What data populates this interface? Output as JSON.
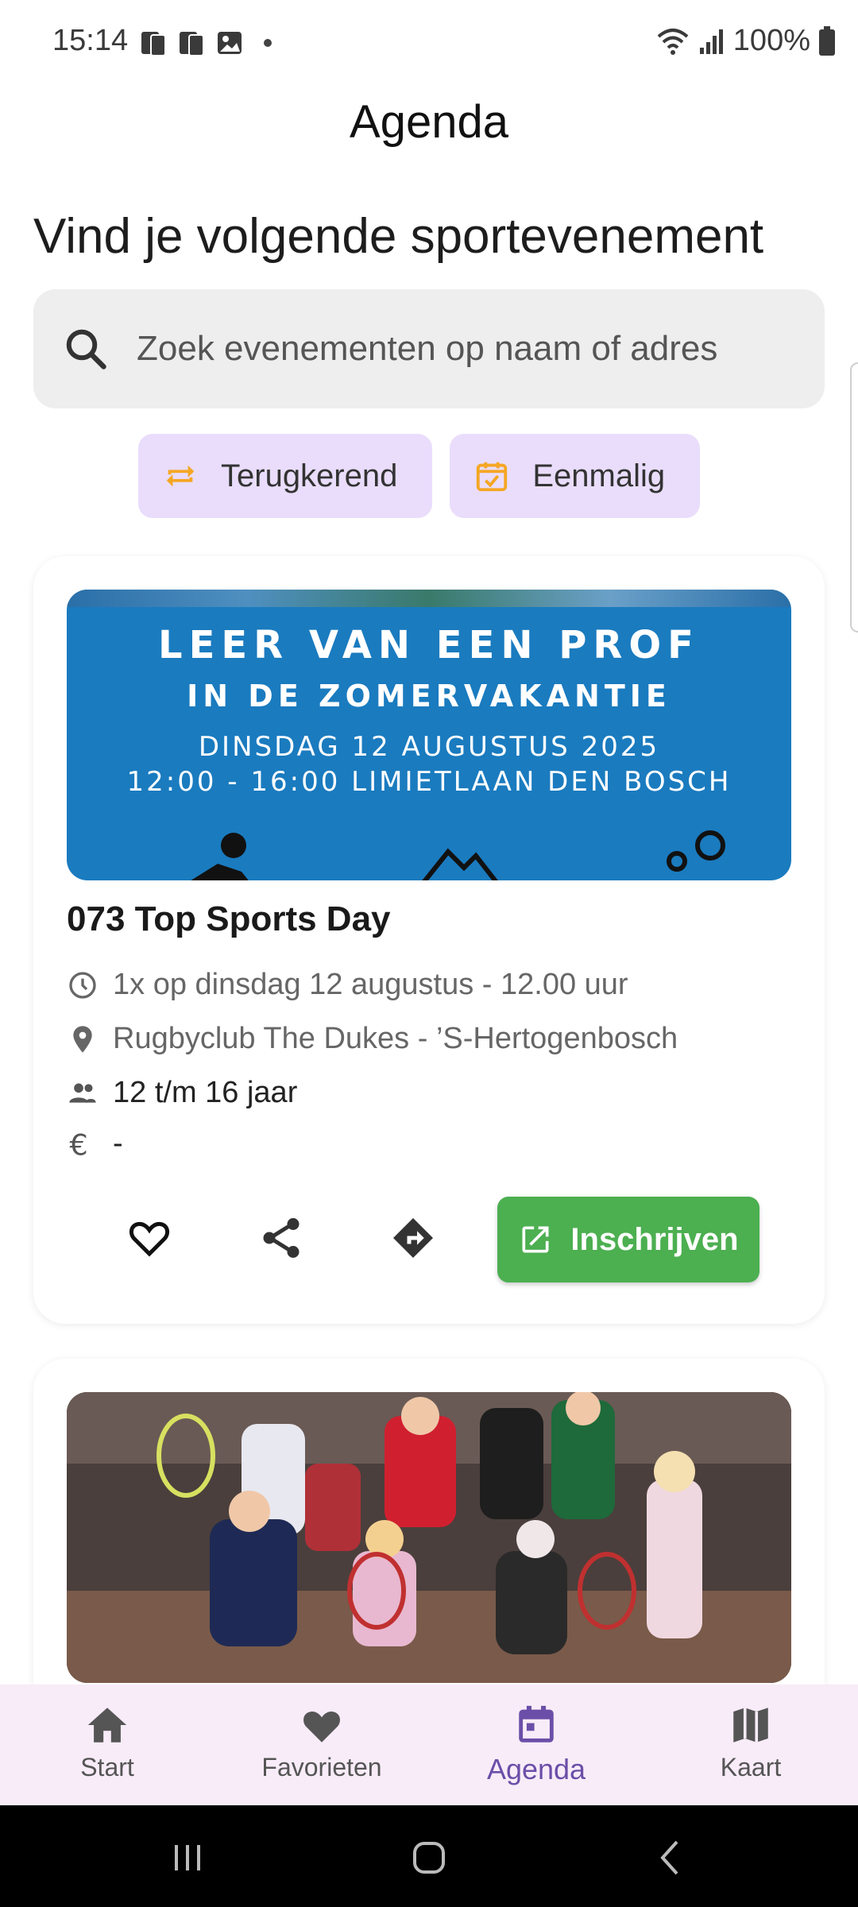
{
  "status_bar": {
    "time": "15:14",
    "battery": "100%",
    "left_icons": [
      "phone-notification-icon",
      "phone-notification-icon",
      "image-notification-icon",
      "dot-icon"
    ],
    "right_icons": [
      "wifi-icon",
      "signal-icon",
      "battery-icon"
    ]
  },
  "header": {
    "title": "Agenda"
  },
  "headline": "Vind je volgende sportevenement",
  "search": {
    "placeholder": "Zoek evenementen op naam of adres",
    "value": ""
  },
  "filters": [
    {
      "label": "Terugkerend",
      "icon": "repeat-icon",
      "selected": false
    },
    {
      "label": "Eenmalig",
      "icon": "calendar-check-icon",
      "selected": false
    }
  ],
  "events": [
    {
      "banner": {
        "line1": "LEER VAN EEN PROF",
        "line2": "IN DE ZOMERVAKANTIE",
        "line3": "DINSDAG 12 AUGUSTUS 2025",
        "line4": "12:00 - 16:00 LIMIETLAAN DEN BOSCH"
      },
      "title": "073 Top Sports Day",
      "schedule": "1x op dinsdag 12 augustus - 12.00 uur",
      "location": "Rugbyclub The Dukes - ’S-Hertogenbosch",
      "age": "12 t/m 16 jaar",
      "price": "-",
      "signup_label": "Inschrijven"
    },
    {
      "image": "photo of children holding tennis rackets"
    }
  ],
  "bottom_nav": [
    {
      "label": "Start",
      "icon": "home-icon",
      "active": false
    },
    {
      "label": "Favorieten",
      "icon": "heart-icon",
      "active": false
    },
    {
      "label": "Agenda",
      "icon": "calendar-icon",
      "active": true
    },
    {
      "label": "Kaart",
      "icon": "map-icon",
      "active": false
    }
  ],
  "colors": {
    "accent": "#6b4ea8",
    "chip_bg": "#e9ddfb",
    "chip_icon": "#f5a623",
    "signup_green": "#4caf50",
    "nav_bg": "#f8ecf8"
  }
}
